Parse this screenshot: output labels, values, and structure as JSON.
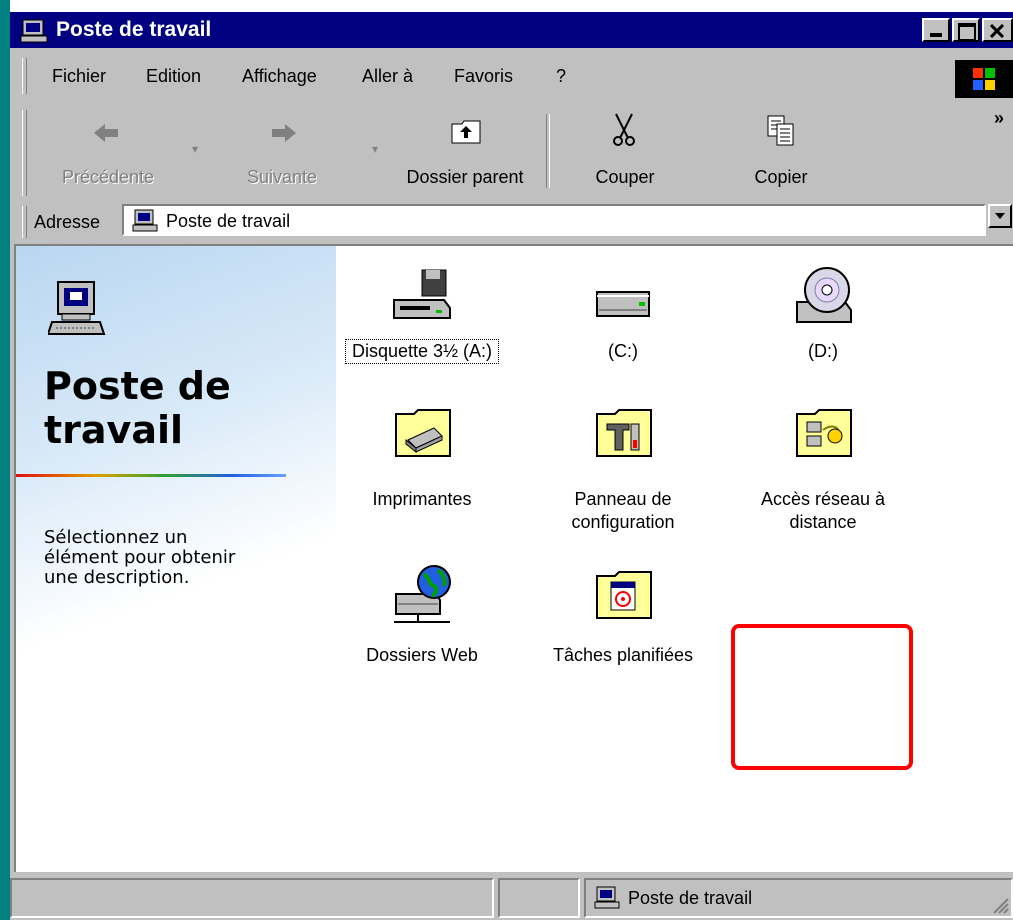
{
  "window": {
    "title": "Poste de travail"
  },
  "menu": {
    "items": [
      "Fichier",
      "Edition",
      "Affichage",
      "Aller à",
      "Favoris",
      "?"
    ]
  },
  "toolbar": {
    "buttons": [
      {
        "label": "Précédente",
        "icon": "back-arrow-icon",
        "enabled": false
      },
      {
        "label": "Suivante",
        "icon": "forward-arrow-icon",
        "enabled": false
      },
      {
        "label": "Dossier parent",
        "icon": "up-folder-icon",
        "enabled": true
      },
      {
        "label": "Couper",
        "icon": "scissors-icon",
        "enabled": true
      },
      {
        "label": "Copier",
        "icon": "copy-icon",
        "enabled": true
      }
    ],
    "more": "»"
  },
  "address": {
    "label": "Adresse",
    "value": "Poste de travail"
  },
  "webview": {
    "title": "Poste de travail",
    "description": "Sélectionnez un élément pour obtenir une description."
  },
  "items": [
    {
      "label": "Disquette 3½ (A:)",
      "icon": "floppy-drive-icon"
    },
    {
      "label": "(C:)",
      "icon": "hard-drive-icon"
    },
    {
      "label": "(D:)",
      "icon": "cd-rom-drive-icon"
    },
    {
      "label": "Imprimantes",
      "icon": "printers-folder-icon"
    },
    {
      "label": "Panneau de configuration",
      "icon": "control-panel-folder-icon"
    },
    {
      "label": "Accès réseau à distance",
      "icon": "dial-up-networking-folder-icon",
      "highlighted": true
    },
    {
      "label": "Dossiers Web",
      "icon": "web-folders-icon"
    },
    {
      "label": "Tâches planifiées",
      "icon": "scheduled-tasks-folder-icon"
    }
  ],
  "status": {
    "text": "Poste de travail"
  },
  "colors": {
    "titlebar": "#000080",
    "face": "#c0c0c0",
    "highlight": "#ff0000",
    "desktop": "#008080"
  }
}
